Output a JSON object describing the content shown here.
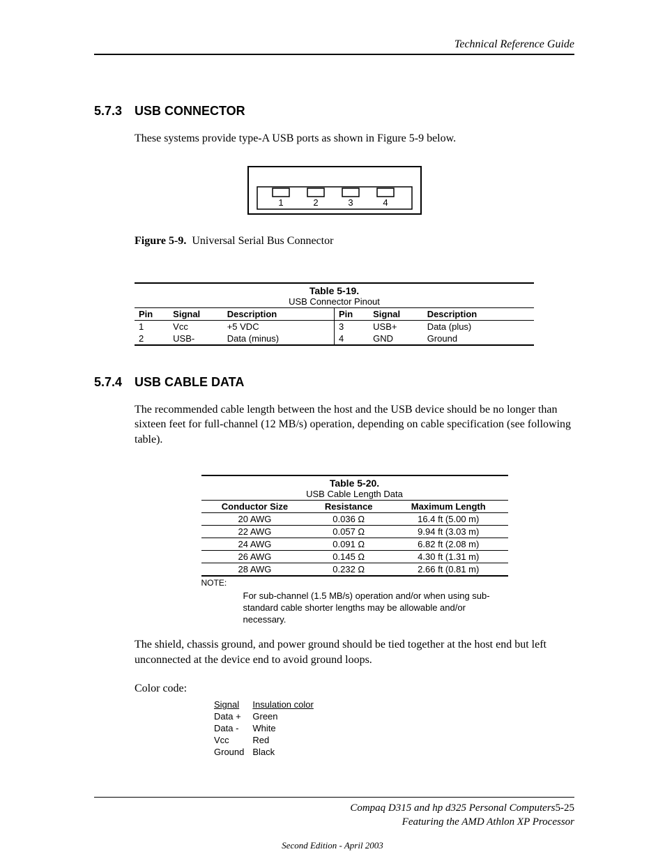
{
  "header": {
    "running_title": "Technical Reference Guide"
  },
  "section573": {
    "number": "5.7.3",
    "title": "USB CONNECTOR",
    "intro": "These systems provide type-A USB ports as shown in Figure 5-9 below.",
    "pin_labels": [
      "1",
      "2",
      "3",
      "4"
    ]
  },
  "figure59": {
    "label": "Figure 5-9.",
    "caption": "Universal Serial Bus Connector"
  },
  "table519": {
    "number": "Table 5-19.",
    "title": "USB Connector Pinout",
    "headers": {
      "pin": "Pin",
      "signal": "Signal",
      "description": "Description"
    },
    "rows_left": [
      {
        "pin": "1",
        "signal": "Vcc",
        "description": "+5 VDC"
      },
      {
        "pin": "2",
        "signal": "USB-",
        "description": "Data (minus)"
      }
    ],
    "rows_right": [
      {
        "pin": "3",
        "signal": "USB+",
        "description": "Data (plus)"
      },
      {
        "pin": "4",
        "signal": "GND",
        "description": "Ground"
      }
    ]
  },
  "section574": {
    "number": "5.7.4",
    "title": "USB CABLE DATA",
    "intro": "The recommended cable length between the host and the USB device should be no longer than sixteen feet for full-channel (12 MB/s) operation, depending on cable specification (see following table)."
  },
  "table520": {
    "number": "Table 5-20.",
    "title": "USB Cable Length Data",
    "headers": {
      "conductor": "Conductor Size",
      "resistance": "Resistance",
      "maxlen": "Maximum Length"
    },
    "rows": [
      {
        "conductor": "20 AWG",
        "resistance": "0.036 Ω",
        "maxlen": "16.4 ft (5.00 m)"
      },
      {
        "conductor": "22 AWG",
        "resistance": "0.057 Ω",
        "maxlen": "9.94 ft (3.03 m)"
      },
      {
        "conductor": "24 AWG",
        "resistance": "0.091 Ω",
        "maxlen": "6.82 ft (2.08 m)"
      },
      {
        "conductor": "26 AWG",
        "resistance": "0.145 Ω",
        "maxlen": "4.30 ft (1.31 m)"
      },
      {
        "conductor": "28 AWG",
        "resistance": "0.232 Ω",
        "maxlen": "2.66 ft (0.81 m)"
      }
    ],
    "note_label": "NOTE:",
    "note_text": "For sub-channel (1.5 MB/s) operation and/or when using sub-standard cable shorter lengths may be allowable and/or necessary."
  },
  "post_table_text": "The shield, chassis ground, and power ground should be tied together at the host end but left unconnected at the device end to avoid ground loops.",
  "color_code": {
    "label": "Color code:",
    "headers": {
      "signal": "Signal",
      "color": "Insulation color"
    },
    "rows": [
      {
        "signal": "Data +",
        "color": "Green"
      },
      {
        "signal": "Data -",
        "color": "White"
      },
      {
        "signal": "Vcc",
        "color": "Red"
      },
      {
        "signal": "Ground",
        "color": "Black"
      }
    ]
  },
  "footer": {
    "line1_left": "Compaq D315 and hp d325 Personal Computers",
    "page_number": "5-25",
    "line2": "Featuring the AMD Athlon XP Processor",
    "edition": "Second Edition - April 2003"
  }
}
